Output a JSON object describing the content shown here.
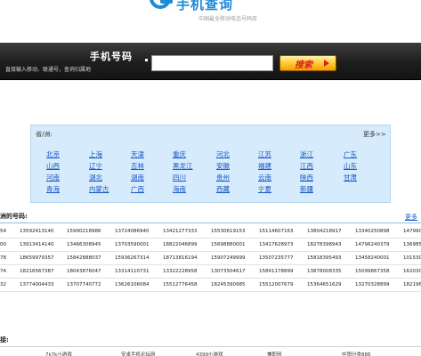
{
  "logo": {
    "text": "手机查询",
    "slogan": "中国最全移动电话号码库"
  },
  "search": {
    "title": "手机号码",
    "hint": "直接输入移动、联通号，查询归属地",
    "input_value": "",
    "button_label": "搜索"
  },
  "provinces": {
    "header": "省/洲:",
    "more": "更多>>",
    "items": [
      "北京",
      "上海",
      "天津",
      "重庆",
      "河北",
      "江苏",
      "浙江",
      "广东",
      "山西",
      "辽宁",
      "吉林",
      "黑龙江",
      "安徽",
      "福建",
      "江西",
      "山东",
      "河南",
      "湖北",
      "湖南",
      "四川",
      "贵州",
      "云南",
      "陕西",
      "甘肃",
      "青海",
      "内蒙古",
      "广西",
      "海南",
      "西藏",
      "宁夏",
      "新疆"
    ]
  },
  "numbers": {
    "title": "洲的号码:",
    "more": "更多",
    "rows": [
      [
        "54",
        "13592413140",
        "15990218986",
        "13724086940",
        "13421277333",
        "15530619153",
        "15114607163",
        "13804218917",
        "13340250898",
        "147990"
      ],
      [
        "00",
        "13913414140",
        "13466308945",
        "13703590001",
        "18822046899",
        "15698880001",
        "13417628973",
        "18278398943",
        "14796240379",
        "136985"
      ],
      [
        "78",
        "18659979357",
        "15842888037",
        "15936267314",
        "18713816194",
        "15907249999",
        "13507235777",
        "15818395493",
        "13458240001",
        "101530"
      ],
      [
        "74",
        "18216567387",
        "18043876047",
        "13314110731",
        "13322228958",
        "13073504617",
        "15841178899",
        "13878008335",
        "15099867358",
        "162030"
      ],
      [
        "32",
        "13774004433",
        "13707740772",
        "13626106084",
        "15512776458",
        "18245390985",
        "15512007679",
        "15364651629",
        "13270328899",
        "182196"
      ]
    ]
  },
  "links": {
    "title": "接:",
    "items": [
      "7k7k小游戏",
      "安卓手机论坛网",
      "4399小游戏",
      "兼职网",
      "中国分类886"
    ]
  }
}
